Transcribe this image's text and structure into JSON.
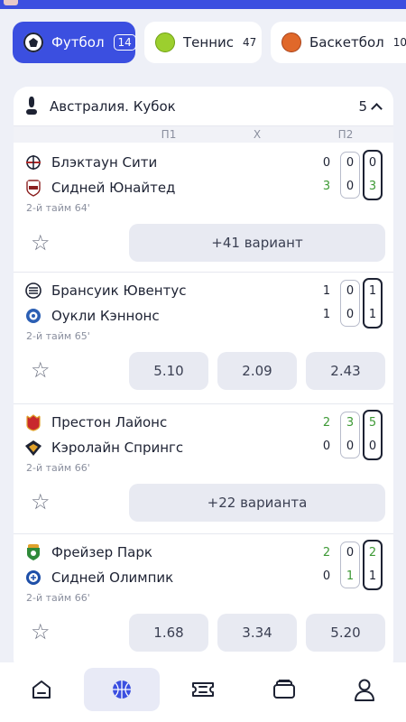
{
  "sports": [
    {
      "label": "Футбол",
      "count": "14",
      "icon": "football-icon"
    },
    {
      "label": "Теннис",
      "count": "47",
      "icon": "tennis-ball-icon"
    },
    {
      "label": "Баскетбол",
      "count": "10",
      "icon": "basketball-icon"
    }
  ],
  "league": {
    "name": "Австралия. Кубок",
    "count": "5"
  },
  "columns": {
    "p1": "П1",
    "x": "Х",
    "p2": "П2"
  },
  "matches": [
    {
      "home": "Блэктаун Сити",
      "away": "Сидней Юнайтед",
      "status": "2-й тайм 64'",
      "home_scores": [
        "0",
        "0",
        "0"
      ],
      "away_scores": [
        "3",
        "0",
        "3"
      ],
      "action": "+41 вариант"
    },
    {
      "home": "Брансуик Ювентус",
      "away": "Оукли Кэннонс",
      "status": "2-й тайм 65'",
      "home_scores": [
        "1",
        "0",
        "1"
      ],
      "away_scores": [
        "1",
        "0",
        "1"
      ],
      "odds": [
        "5.10",
        "2.09",
        "2.43"
      ]
    },
    {
      "home": "Престон Лайонс",
      "away": "Кэролайн Спрингс",
      "status": "2-й тайм 66'",
      "home_scores": [
        "2",
        "3",
        "5"
      ],
      "away_scores": [
        "0",
        "0",
        "0"
      ],
      "action": "+22 варианта"
    },
    {
      "home": "Фрейзер Парк",
      "away": "Сидней Олимпик",
      "status": "2-й тайм 66'",
      "home_scores": [
        "2",
        "0",
        "2"
      ],
      "away_scores": [
        "0",
        "1",
        "1"
      ],
      "odds": [
        "1.68",
        "3.34",
        "5.20"
      ]
    }
  ],
  "nav": [
    "home-icon",
    "basketball-icon",
    "ticket-icon",
    "wallet-icon",
    "profile-icon"
  ],
  "colors": {
    "accent": "#3b4fe0",
    "score_green": "#3e9a36"
  }
}
